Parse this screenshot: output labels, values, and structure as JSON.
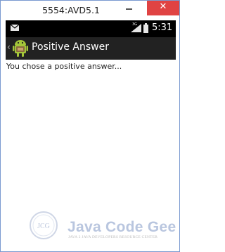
{
  "window": {
    "title": "5554:AVD5.1",
    "close_glyph": "✕"
  },
  "statusbar": {
    "notification_icon": "mail-icon",
    "network_label": "3G",
    "time": "5:31"
  },
  "actionbar": {
    "up_glyph": "‹",
    "app_icon": "android-icon",
    "title": "Positive Answer"
  },
  "content": {
    "message": "You chose a positive answer..."
  },
  "watermark": {
    "logo_text": "JCG",
    "brand": "Java Code Geeks",
    "tagline": "JAVA 2 JAVA DEVELOPERS RESOURCE CENTER"
  },
  "colors": {
    "close_button": "#e04343",
    "statusbar": "#000000",
    "actionbar": "#222222",
    "android_green": "#a4c639"
  }
}
